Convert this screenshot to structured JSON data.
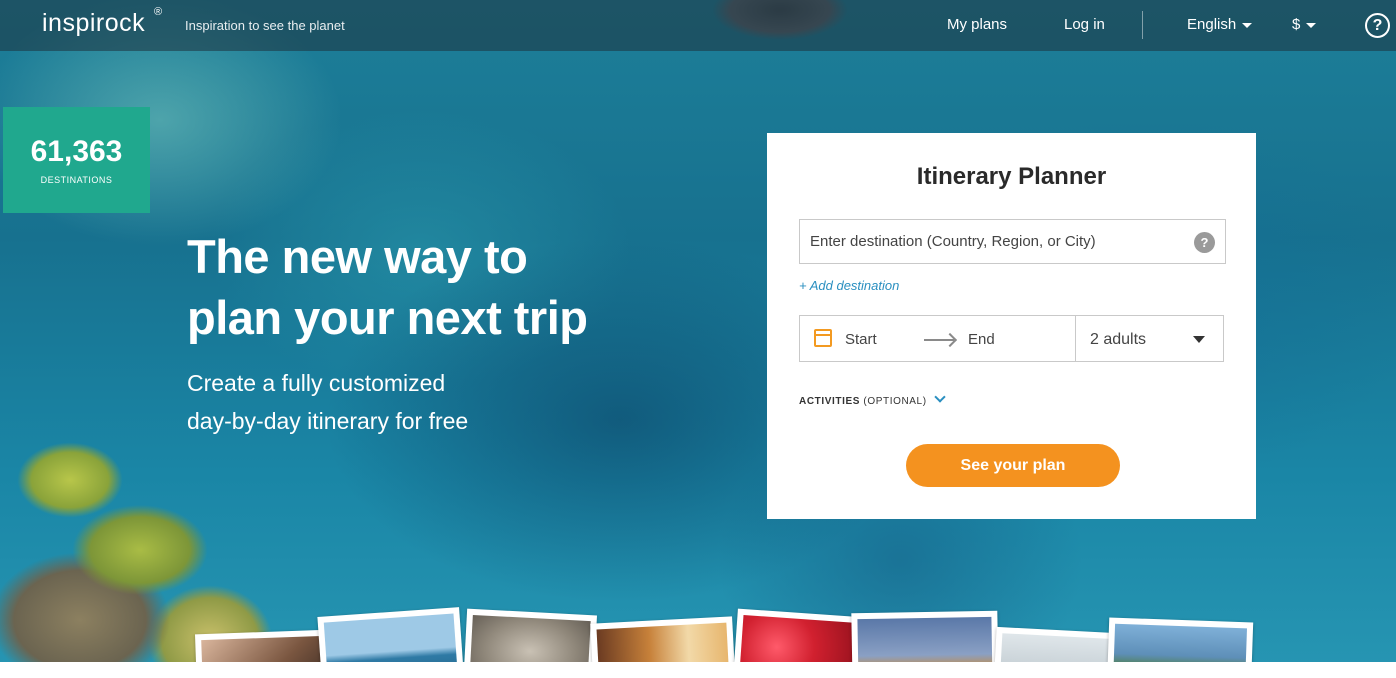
{
  "header": {
    "logo": "inspirock",
    "logo_mark": "®",
    "tagline": "Inspiration to see the planet",
    "nav": {
      "my_plans": "My plans",
      "log_in": "Log in",
      "language": "English",
      "currency": "$",
      "help": "?"
    }
  },
  "stats": {
    "count": "61,363",
    "label": "DESTINATIONS"
  },
  "hero": {
    "headline_line1": "The new way to",
    "headline_line2": "plan your next trip",
    "subhead_line1": "Create a fully customized",
    "subhead_line2": "day-by-day itinerary for free"
  },
  "planner": {
    "title": "Itinerary Planner",
    "destination_placeholder": "Enter destination (Country, Region, or City)",
    "destination_value": "",
    "help_icon": "?",
    "add_destination": "+ Add destination",
    "start_label": "Start",
    "end_label": "End",
    "guests_value": "2 adults",
    "activities_label": "ACTIVITIES",
    "activities_optional": "(OPTIONAL)",
    "cta": "See your plan"
  },
  "colors": {
    "accent_green": "#20a88e",
    "cta_orange": "#f4921f",
    "link_blue": "#2a8fc0"
  },
  "icons": [
    "help-icon",
    "question-icon",
    "calendar-icon",
    "arrow-right-icon",
    "caret-down-icon",
    "chevron-down-icon"
  ]
}
